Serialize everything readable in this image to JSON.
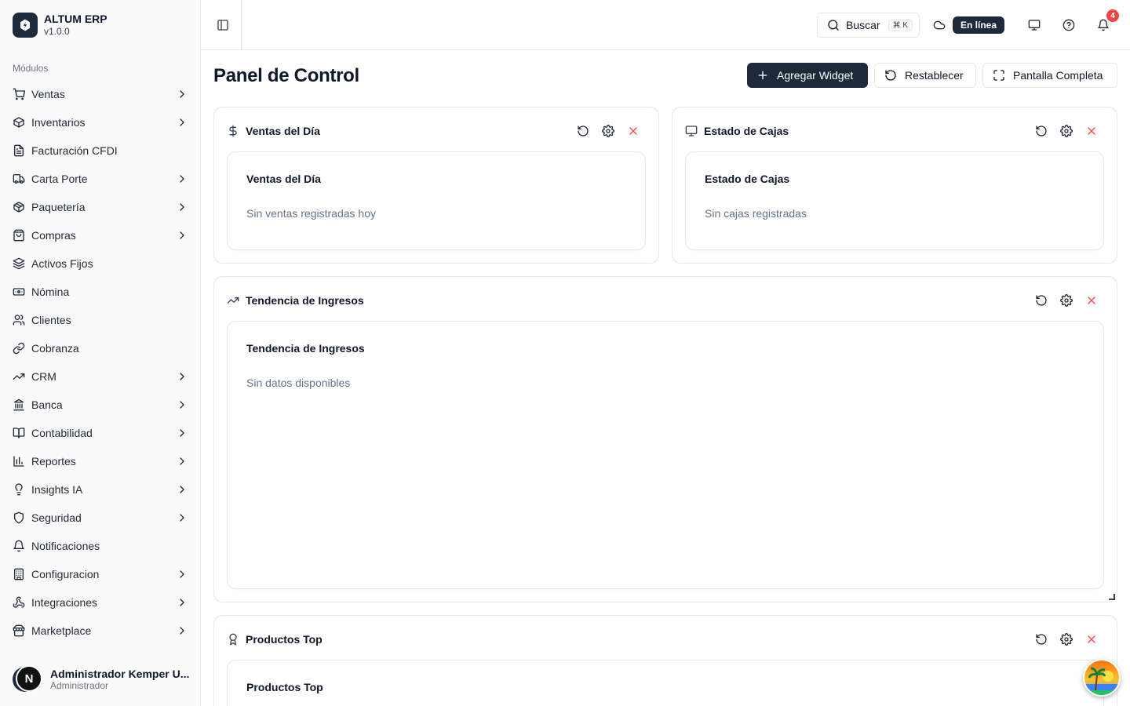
{
  "brand": {
    "name": "ALTUM ERP",
    "version": "v1.0.0"
  },
  "sidebar": {
    "section_label": "Módulos",
    "items": [
      {
        "label": "Ventas",
        "icon": "cart-icon",
        "has_children": true
      },
      {
        "label": "Inventarios",
        "icon": "package-icon",
        "has_children": true
      },
      {
        "label": "Facturación CFDI",
        "icon": "file-text-icon",
        "has_children": false
      },
      {
        "label": "Carta Porte",
        "icon": "truck-icon",
        "has_children": true
      },
      {
        "label": "Paquetería",
        "icon": "box-icon",
        "has_children": true
      },
      {
        "label": "Compras",
        "icon": "shopping-bag-icon",
        "has_children": true
      },
      {
        "label": "Activos Fijos",
        "icon": "layers-icon",
        "has_children": false
      },
      {
        "label": "Nómina",
        "icon": "banknote-icon",
        "has_children": false
      },
      {
        "label": "Clientes",
        "icon": "users-icon",
        "has_children": false
      },
      {
        "label": "Cobranza",
        "icon": "link-icon",
        "has_children": false
      },
      {
        "label": "CRM",
        "icon": "trending-up-icon",
        "has_children": true
      },
      {
        "label": "Banca",
        "icon": "landmark-icon",
        "has_children": true
      },
      {
        "label": "Contabilidad",
        "icon": "book-open-icon",
        "has_children": true
      },
      {
        "label": "Reportes",
        "icon": "bar-chart-icon",
        "has_children": true
      },
      {
        "label": "Insights IA",
        "icon": "lightbulb-icon",
        "has_children": true
      },
      {
        "label": "Seguridad",
        "icon": "shield-icon",
        "has_children": true
      },
      {
        "label": "Notificaciones",
        "icon": "bell-icon",
        "has_children": false
      },
      {
        "label": "Configuracion",
        "icon": "building-icon",
        "has_children": true
      },
      {
        "label": "Integraciones",
        "icon": "webhook-icon",
        "has_children": true
      },
      {
        "label": "Marketplace",
        "icon": "store-icon",
        "has_children": true
      }
    ]
  },
  "user": {
    "initial": "N",
    "name": "Administrador Kemper U...",
    "role": "Administrador"
  },
  "topbar": {
    "search_label": "Buscar",
    "search_shortcut": "⌘ K",
    "status": "En línea",
    "notification_count": "4"
  },
  "page": {
    "title": "Panel de Control",
    "add_widget": "Agregar Widget",
    "reset": "Restablecer",
    "fullscreen": "Pantalla Completa"
  },
  "widgets": {
    "sales": {
      "title": "Ventas del Día",
      "inner_title": "Ventas del Día",
      "empty": "Sin ventas registradas hoy"
    },
    "cash": {
      "title": "Estado de Cajas",
      "inner_title": "Estado de Cajas",
      "empty": "Sin cajas registradas"
    },
    "revenue": {
      "title": "Tendencia de Ingresos",
      "inner_title": "Tendencia de Ingresos",
      "empty": "Sin datos disponibles"
    },
    "products": {
      "title": "Productos Top",
      "inner_title": "Productos Top"
    }
  },
  "colors": {
    "primary": "#1e293b",
    "danger": "#ef4444",
    "muted": "#64748b",
    "border": "#e5e7eb"
  }
}
